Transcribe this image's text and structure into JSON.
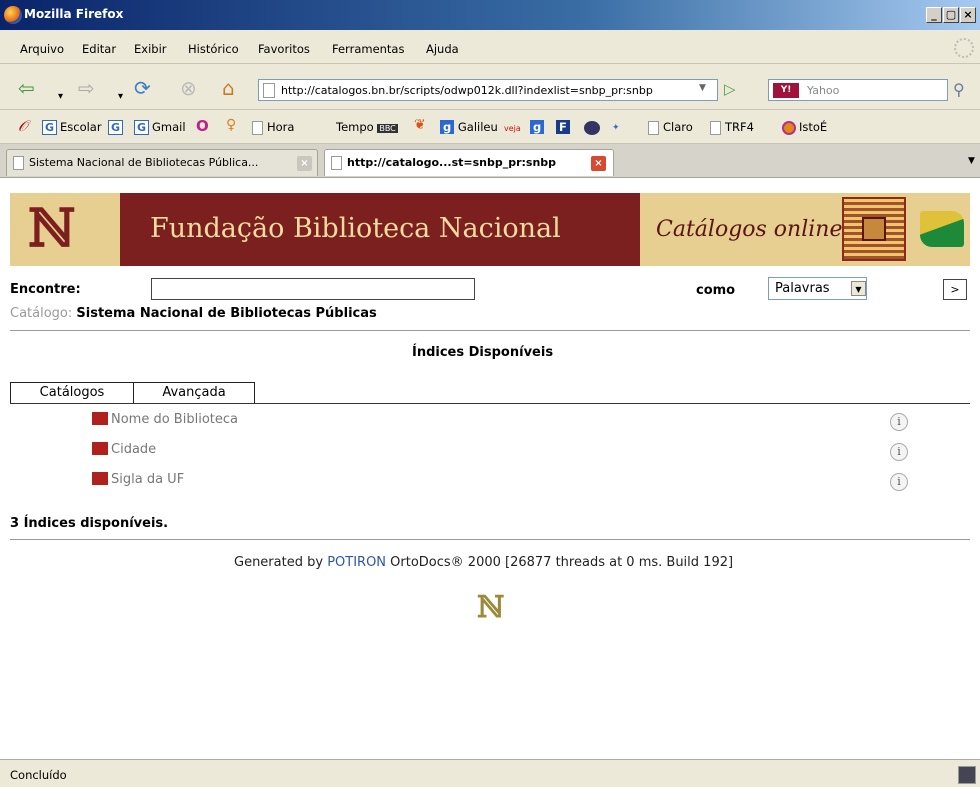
{
  "window": {
    "title": "Mozilla Firefox",
    "min": "_",
    "max": "́❐",
    "close": "x"
  },
  "menu": [
    "Arquivo",
    "Editar",
    "Exibir",
    "Histórico",
    "Favoritos",
    "Ferramentas",
    "Ajuda"
  ],
  "nav": {
    "back_icon": "back-arrow-icon",
    "url": "http://catalogos.bn.br/scripts/odwp012k.dll?indexlist=snbp_pr:snbp",
    "search_placeholder": "Yahoo",
    "search_engine": "Y!"
  },
  "bookmarks": [
    "Escolar",
    "Gmail",
    "Hora",
    "Tempo",
    "Galileu",
    "Claro",
    "TRF4",
    "IstoÉ"
  ],
  "tabs": [
    {
      "label": "Sistema Nacional de Bibliotecas Pública...",
      "active": false
    },
    {
      "label": "http://catalogo...st=snbp_pr:snbp",
      "active": true
    }
  ],
  "banner": {
    "title": "Fundação Biblioteca Nacional",
    "catalogos": "Catálogos online"
  },
  "search": {
    "label": "Encontre:",
    "value": "",
    "como_label": "como",
    "mode": "Palavras",
    "go": ">"
  },
  "catalog": {
    "label": "Catálogo:",
    "name": "Sistema Nacional de Bibliotecas Públicas"
  },
  "indices": {
    "heading": "Índices Disponíveis",
    "tabs": [
      "Catálogos",
      "Avançada"
    ],
    "items": [
      "Nome do Biblioteca",
      "Cidade",
      "Sigla da UF"
    ],
    "count_text": "3 Índices disponíveis."
  },
  "footer": {
    "prefix": "Generated by ",
    "brand": "POTIRON",
    "suffix": " OrtoDocs® 2000 [26877 threads at 0 ms. Build 192]"
  },
  "status": "Concluído",
  "colors": {
    "banner": "#7b1f1f",
    "banner_text": "#f2dca0",
    "link": "#2e55a8",
    "bullet": "#b0201c"
  }
}
